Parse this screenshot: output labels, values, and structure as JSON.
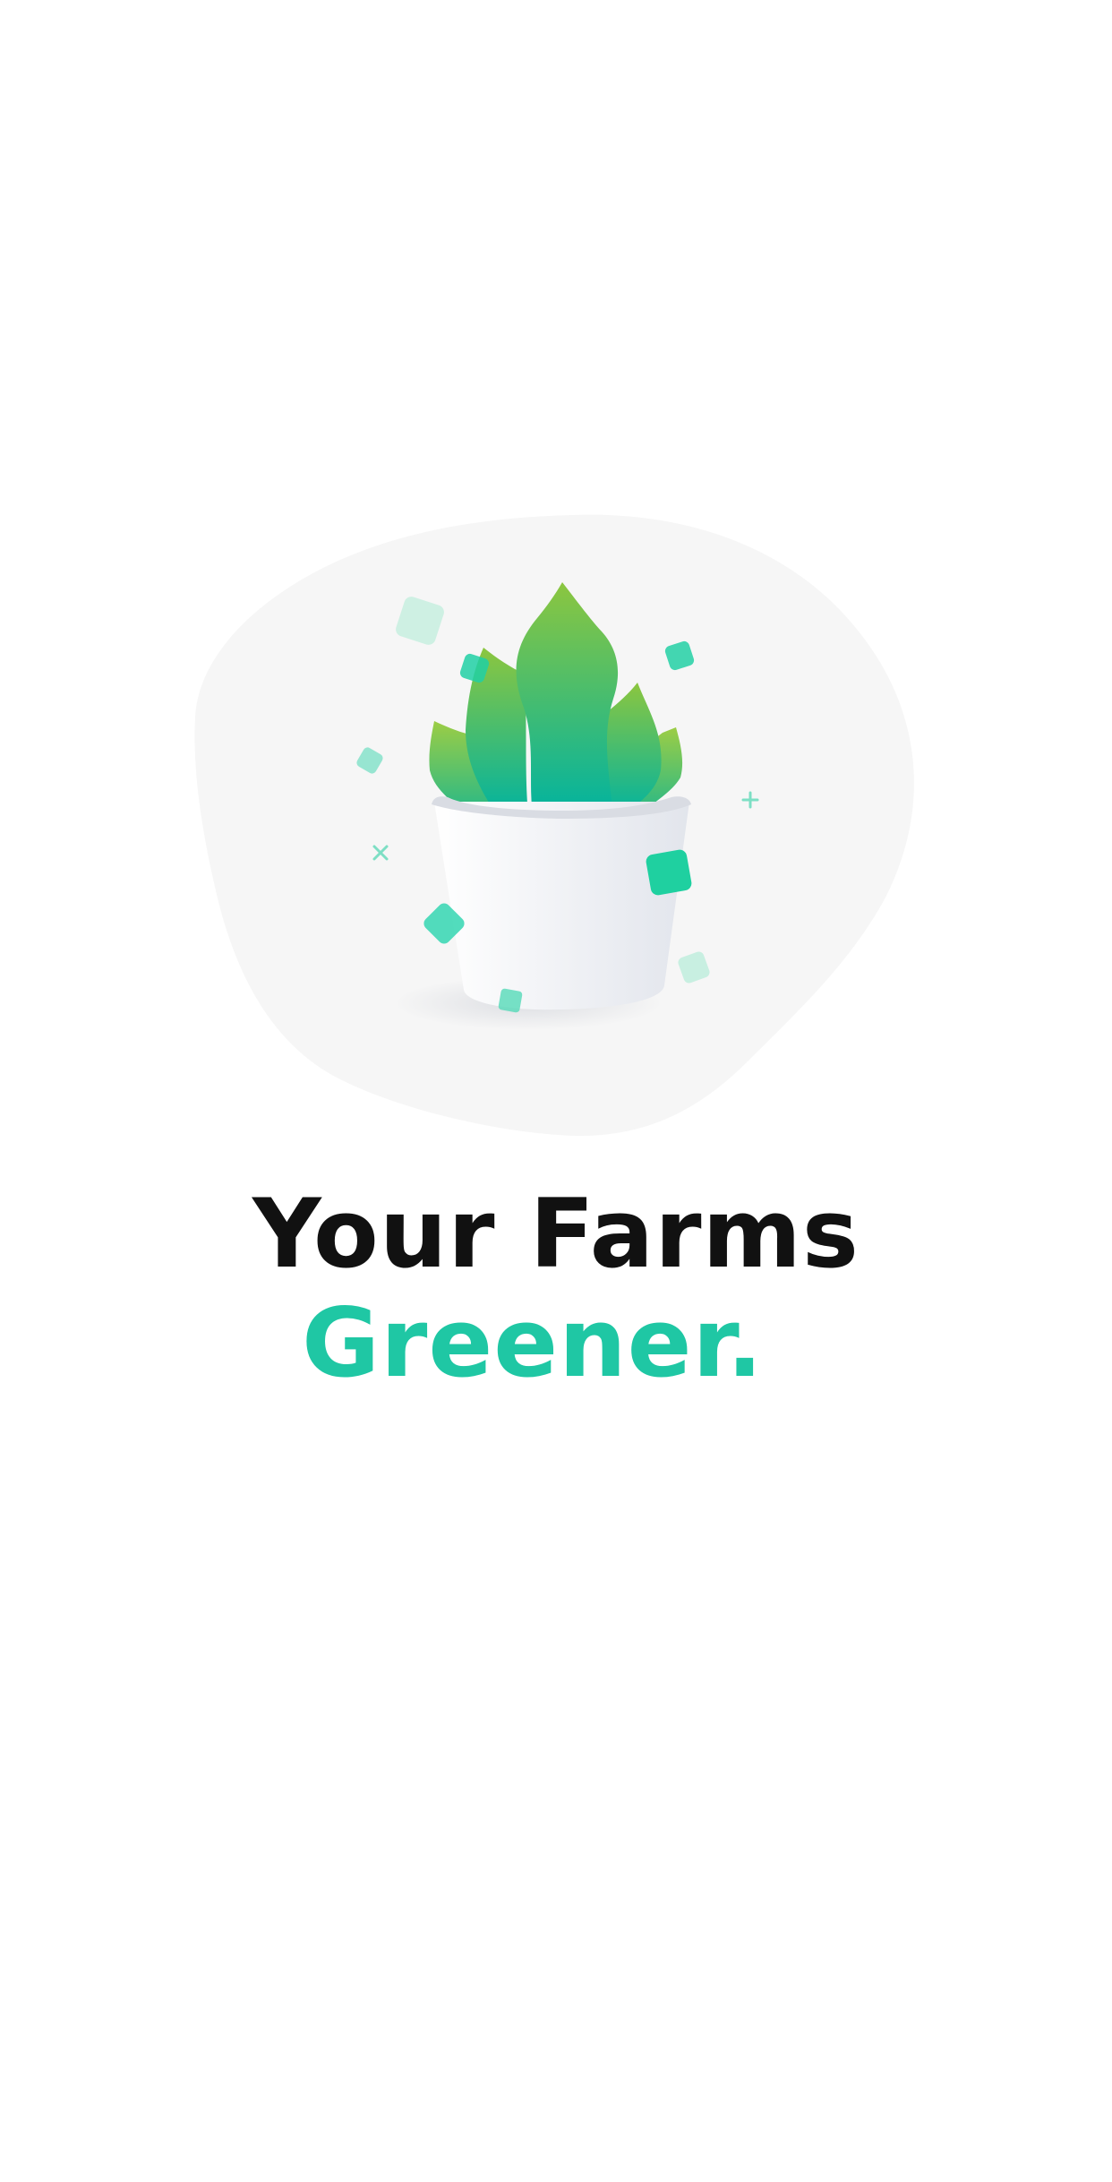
{
  "onboarding": {
    "headline_line1": "Your Farms",
    "headline_line2": "Greener."
  },
  "illustration": {
    "subject": "potted-plant",
    "colors": {
      "blob": "#f6f6f6",
      "leaf_light": "#8cc63f",
      "leaf_dark": "#00b3a0",
      "pot": "#eceef2",
      "accent": "#2ed3a8"
    }
  },
  "colors": {
    "background": "#ffffff",
    "headline_primary": "#111111",
    "headline_accent": "#1fc7a4"
  }
}
